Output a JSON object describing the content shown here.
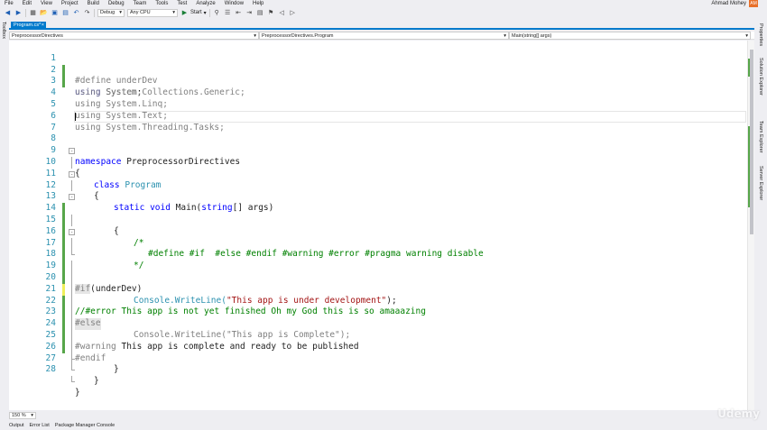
{
  "menu": [
    "File",
    "Edit",
    "View",
    "Project",
    "Build",
    "Debug",
    "Team",
    "Tools",
    "Test",
    "Analyze",
    "Window",
    "Help"
  ],
  "user": {
    "name": "Ahmad Mohey",
    "initials": "AM"
  },
  "toolbar": {
    "config": "Debug",
    "platform": "Any CPU",
    "start": "Start"
  },
  "left_rail": {
    "toolbox": "Toolbox"
  },
  "right_rail": [
    "Properties",
    "Solution Explorer",
    "Team Explorer",
    "Server Explorer"
  ],
  "tab": {
    "label": "Program.cs*",
    "close": "×"
  },
  "nav": {
    "project": "PreprocessorDirectives",
    "type": "PreprocessorDirectives.Program",
    "member": "Main(string[] args)"
  },
  "code": {
    "l1": "#define underDev",
    "l2a": "using",
    "l2b": " System;",
    "l3": "using System.Collections.Generic;",
    "l4": "using System.Linq;",
    "l5": "using System.Text;",
    "l6": "using System.Threading.Tasks;",
    "l8a": "namespace",
    "l8b": " PreprocessorDirectives",
    "l9": "{",
    "l10a": "class",
    "l10b": "Program",
    "l11": "{",
    "l12a": "static",
    "l12b": "void",
    "l12c": " Main(",
    "l12d": "string",
    "l12e": "[] args)",
    "l13": "{",
    "l14": "/*",
    "l15": "#define #if  #else #endif #warning #error #pragma warning disable",
    "l16": "*/",
    "l18a": "#if",
    "l18b": "(underDev)",
    "l19a": "Console.WriteLine(",
    "l19b": "\"This app is under development\"",
    "l19c": ");",
    "l20a": "/",
    "l20b": "/#error",
    "l20c": " This app is not yet finished Oh my God this is so amaaazing",
    "l21": "#else",
    "l22": "Console.WriteLine(\"This app is Complete\");",
    "l23a": "#warning",
    "l23b": " This app is complete and ready to be published",
    "l24": "#endif",
    "l26": "}",
    "l27": "}",
    "l28": "}"
  },
  "line_numbers": [
    "1",
    "2",
    "3",
    "4",
    "5",
    "6",
    "7",
    "8",
    "9",
    "10",
    "11",
    "12",
    "13",
    "14",
    "15",
    "16",
    "17",
    "18",
    "19",
    "20",
    "21",
    "22",
    "23",
    "24",
    "25",
    "26",
    "27",
    "28"
  ],
  "zoom": "150 %",
  "bottom_tabs": [
    "Output",
    "Error List",
    "Package Manager Console"
  ],
  "watermark": "Udemy",
  "colors": {
    "keyword": "#0000ff",
    "type": "#2b91af",
    "string": "#a31515",
    "comment": "#008000",
    "accent": "#007acc"
  }
}
